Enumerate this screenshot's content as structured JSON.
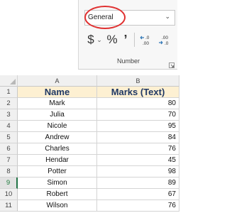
{
  "ribbon": {
    "number_format_value": "General",
    "currency_symbol": "$",
    "currency_chevron": "⌄",
    "percent_symbol": "%",
    "comma_symbol": "’",
    "group_label": "Number",
    "icons": {
      "dropdown": "chevron-down-icon",
      "currency": "currency-icon",
      "percent": "percent-icon",
      "comma": "comma-style-icon",
      "increase_decimal": "increase-decimal-icon",
      "decrease_decimal": "decrease-decimal-icon",
      "launcher": "dialog-launcher-icon"
    },
    "highlight_color": "#e03131"
  },
  "sheet": {
    "columns": [
      "A",
      "B"
    ],
    "header_row": {
      "row": "1",
      "name": "Name",
      "marks": "Marks (Text)"
    },
    "rows": [
      {
        "row": "2",
        "name": "Mark",
        "marks": "80"
      },
      {
        "row": "3",
        "name": "Julia",
        "marks": "70"
      },
      {
        "row": "4",
        "name": "Nicole",
        "marks": "95"
      },
      {
        "row": "5",
        "name": "Andrew",
        "marks": "84"
      },
      {
        "row": "6",
        "name": "Charles",
        "marks": "76"
      },
      {
        "row": "7",
        "name": "Hendar",
        "marks": "45"
      },
      {
        "row": "8",
        "name": "Potter",
        "marks": "98"
      },
      {
        "row": "9",
        "name": "Simon",
        "marks": "89"
      },
      {
        "row": "10",
        "name": "Robert",
        "marks": "67"
      },
      {
        "row": "11",
        "name": "Wilson",
        "marks": "76"
      }
    ],
    "selected_row": "9",
    "colors": {
      "header_fill": "#fdf0d2",
      "header_text": "#1f3864",
      "select_accent": "#217346"
    }
  }
}
